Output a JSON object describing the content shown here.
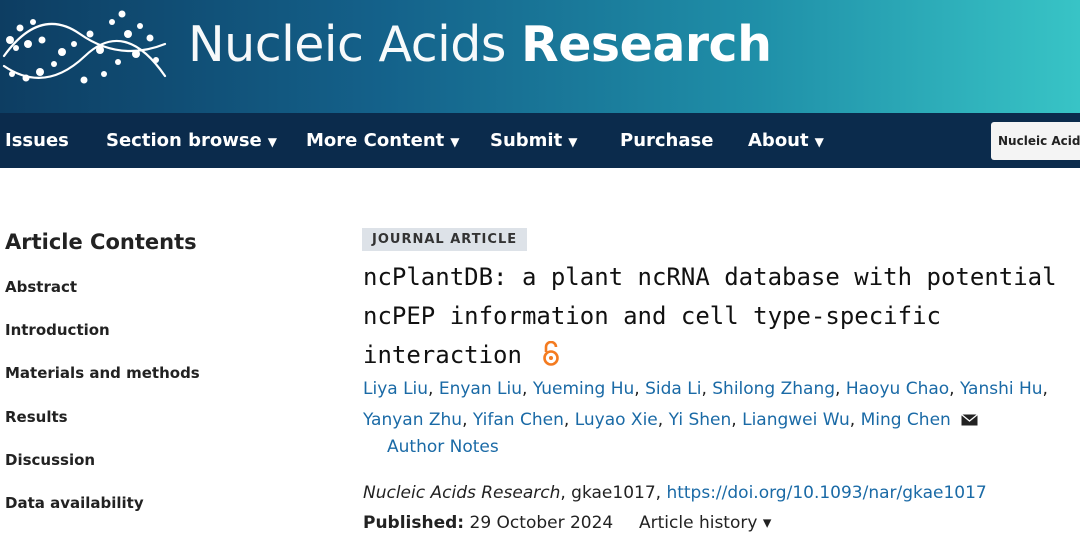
{
  "header": {
    "brand_regular": "Nucleic Acids",
    "brand_bold": "Research",
    "colors": {
      "banner_start": "#0d3d62",
      "banner_end": "#38c4c6",
      "nav_bg": "#0b2b4c"
    }
  },
  "nav": {
    "items": [
      {
        "label": "Issues",
        "has_caret": false
      },
      {
        "label": "Section browse",
        "has_caret": true
      },
      {
        "label": "More Content",
        "has_caret": true
      },
      {
        "label": "Submit",
        "has_caret": true
      },
      {
        "label": "Purchase",
        "has_caret": false
      },
      {
        "label": "About",
        "has_caret": true
      }
    ],
    "journal_select_value": "Nucleic Acids"
  },
  "sidebar": {
    "title": "Article Contents",
    "items": [
      "Abstract",
      "Introduction",
      "Materials and methods",
      "Results",
      "Discussion",
      "Data availability"
    ]
  },
  "article": {
    "type_badge": "JOURNAL ARTICLE",
    "title": "ncPlantDB: a plant ncRNA database with potential ncPEP information and cell type-specific interaction",
    "authors": [
      "Liya Liu",
      "Enyan Liu",
      "Yueming Hu",
      "Sida Li",
      "Shilong Zhang",
      "Haoyu Chao",
      "Yanshi Hu",
      "Yanyan Zhu",
      "Yifan Chen",
      "Luyao Xie",
      "Yi Shen",
      "Liangwei Wu",
      "Ming Chen"
    ],
    "author_notes": "Author Notes",
    "journal": "Nucleic Acids Research",
    "article_id": ", gkae1017, ",
    "doi": "https://doi.org/10.1093/nar/gkae1017",
    "published_label": "Published:",
    "published_date": "29 October 2024",
    "history_label": "Article history ▾",
    "link_color": "#1a6aa6"
  }
}
